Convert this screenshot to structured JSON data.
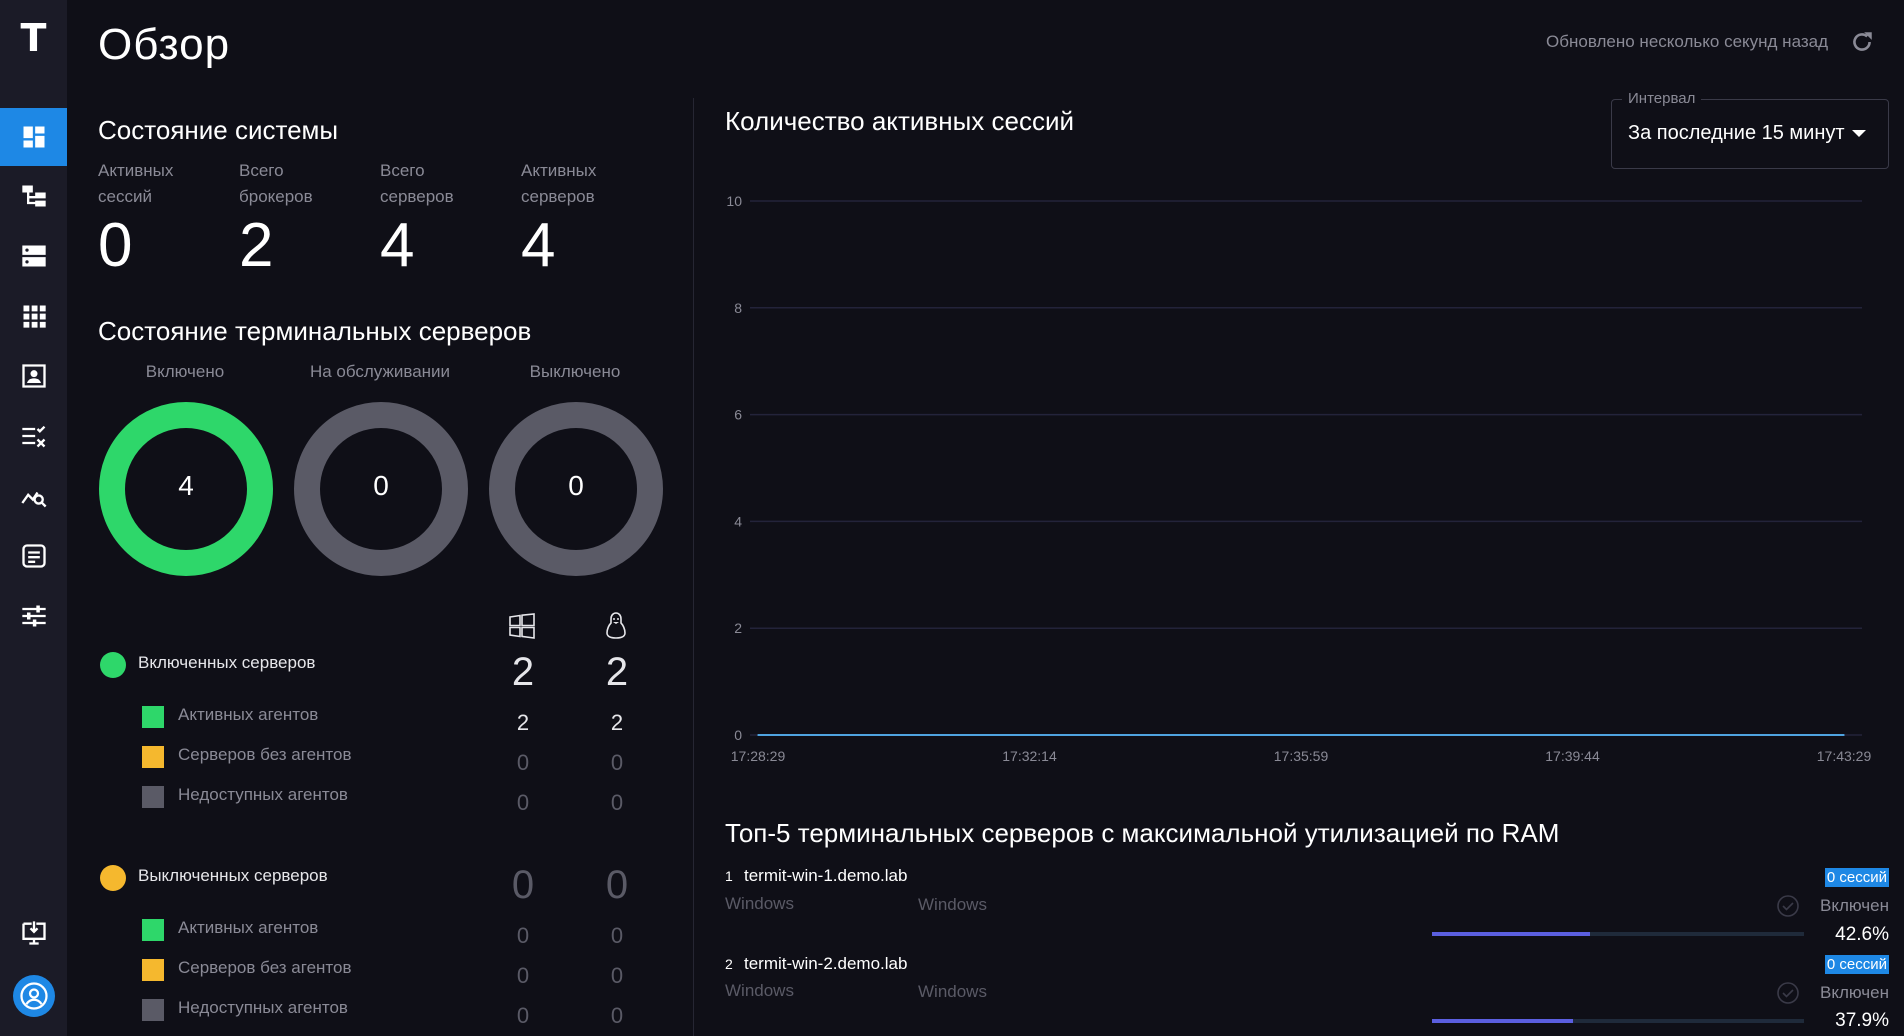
{
  "app": {
    "logo": "T"
  },
  "header": {
    "title": "Обзор",
    "updated": "Обновлено несколько секунд назад"
  },
  "sidebar": {
    "items": [
      {
        "name": "dashboard-icon",
        "active": true
      },
      {
        "name": "hierarchy-icon"
      },
      {
        "name": "servers-icon"
      },
      {
        "name": "apps-grid-icon"
      },
      {
        "name": "user-card-icon"
      },
      {
        "name": "list-check-icon"
      },
      {
        "name": "analytics-search-icon"
      },
      {
        "name": "terminal-list-icon"
      },
      {
        "name": "sliders-icon"
      }
    ],
    "bottom": [
      {
        "name": "download-monitor-icon"
      },
      {
        "name": "user-avatar-icon"
      }
    ]
  },
  "system_state": {
    "title": "Состояние системы",
    "stats": [
      {
        "label1": "Активных",
        "label2": "сессий",
        "value": "0"
      },
      {
        "label1": "Всего",
        "label2": "брокеров",
        "value": "2"
      },
      {
        "label1": "Всего",
        "label2": "серверов",
        "value": "4"
      },
      {
        "label1": "Активных",
        "label2": "серверов",
        "value": "4"
      }
    ]
  },
  "terminal_state": {
    "title": "Состояние терминальных серверов",
    "rings": [
      {
        "label": "Включено",
        "value": "4",
        "color": "#2ed76a"
      },
      {
        "label": "На обслуживании",
        "value": "0",
        "color": "#5a5a66"
      },
      {
        "label": "Выключено",
        "value": "0",
        "color": "#5a5a66"
      }
    ],
    "os_icons": [
      "windows-icon",
      "linux-icon"
    ],
    "groups": [
      {
        "label": "Включенных серверов",
        "dot_color": "#2ed76a",
        "win_total": "2",
        "linux_total": "2",
        "rows": [
          {
            "label": "Активных агентов",
            "color": "#2ed76a",
            "win": "2",
            "linux": "2"
          },
          {
            "label": "Серверов без агентов",
            "color": "#f5b82e",
            "win": "0",
            "linux": "0"
          },
          {
            "label": "Недоступных агентов",
            "color": "#5a5a66",
            "win": "0",
            "linux": "0"
          }
        ]
      },
      {
        "label": "Выключенных серверов",
        "dot_color": "#f5b82e",
        "win_total": "0",
        "linux_total": "0",
        "rows": [
          {
            "label": "Активных агентов",
            "color": "#2ed76a",
            "win": "0",
            "linux": "0"
          },
          {
            "label": "Серверов без агентов",
            "color": "#f5b82e",
            "win": "0",
            "linux": "0"
          },
          {
            "label": "Недоступных агентов",
            "color": "#5a5a66",
            "win": "0",
            "linux": "0"
          }
        ]
      }
    ]
  },
  "sessions_chart": {
    "title": "Количество активных сессий",
    "interval_label": "Интервал",
    "interval_value": "За последние 15 минут"
  },
  "chart_data": {
    "type": "line",
    "title": "Количество активных сессий",
    "xlabel": "",
    "ylabel": "",
    "x": [
      "17:28:29",
      "17:32:14",
      "17:35:59",
      "17:39:44",
      "17:43:29"
    ],
    "series": [
      {
        "values": [
          0,
          0,
          0,
          0,
          0
        ]
      }
    ],
    "ylim": [
      0,
      10
    ],
    "yticks": [
      "0",
      "2",
      "4",
      "6",
      "8",
      "10"
    ],
    "grid": true,
    "line_color": "#4fa3e0"
  },
  "top_ram": {
    "title": "Топ-5 терминальных серверов с максимальной утилизацией по RAM",
    "servers": [
      {
        "rank": "1",
        "name": "termit-win-1.demo.lab",
        "os1": "Windows",
        "os2": "Windows",
        "sessions": "0 сессий",
        "status": "Включен",
        "pct": "42.6%",
        "fraction": 0.426
      },
      {
        "rank": "2",
        "name": "termit-win-2.demo.lab",
        "os1": "Windows",
        "os2": "Windows",
        "sessions": "0 сессий",
        "status": "Включен",
        "pct": "37.9%",
        "fraction": 0.379
      }
    ]
  }
}
